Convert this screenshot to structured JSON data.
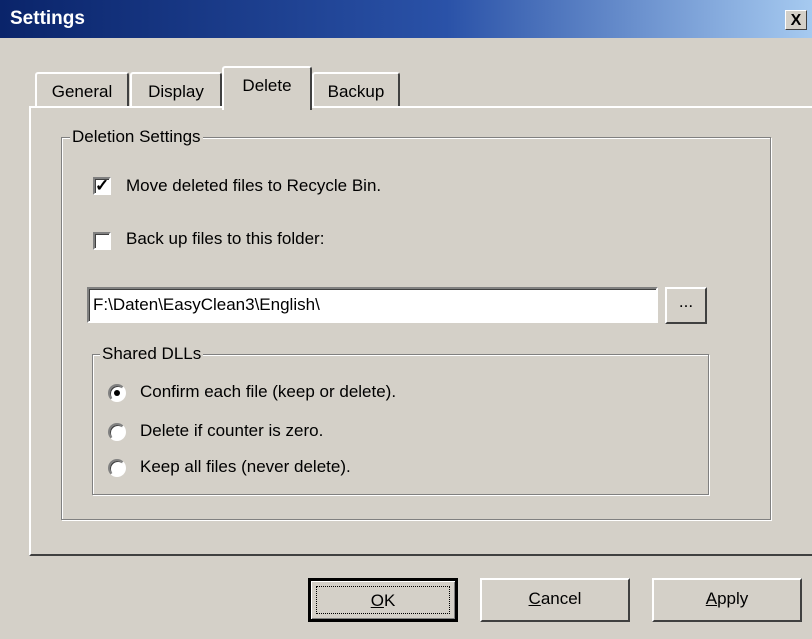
{
  "window": {
    "title": "Settings",
    "close_glyph": "X"
  },
  "tabs": [
    {
      "label": "General",
      "active": false
    },
    {
      "label": "Display",
      "active": false
    },
    {
      "label": "Delete",
      "active": true
    },
    {
      "label": "Backup",
      "active": false
    }
  ],
  "deletion_settings": {
    "group_label": "Deletion Settings",
    "move_to_recycle": {
      "label": "Move deleted files to Recycle Bin.",
      "checked": true
    },
    "backup_files": {
      "label": "Back up files to this folder:",
      "checked": false
    },
    "folder_path": "F:\\Daten\\EasyClean3\\English\\",
    "browse_label": "...",
    "shared_dlls": {
      "group_label": "Shared DLLs",
      "options": [
        {
          "label": "Confirm each file (keep or delete).",
          "selected": true
        },
        {
          "label": "Delete if counter is zero.",
          "selected": false
        },
        {
          "label": "Keep all files (never delete).",
          "selected": false
        }
      ]
    }
  },
  "buttons": {
    "ok": {
      "mnemonic": "O",
      "rest": "K"
    },
    "cancel": {
      "mnemonic": "C",
      "rest": "ancel"
    },
    "apply": {
      "mnemonic": "A",
      "rest": "pply"
    }
  }
}
